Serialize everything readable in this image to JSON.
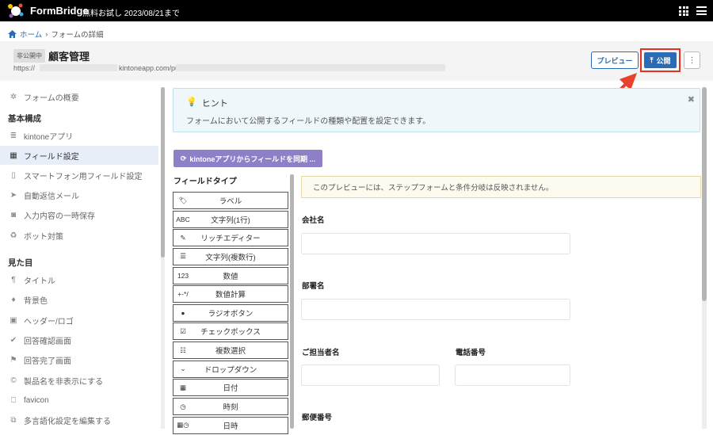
{
  "topbar": {
    "brand": "FormBridge",
    "trial_text": "無料お試し 2023/08/21まで"
  },
  "breadcrumb": {
    "home": "ホーム",
    "separator": "›",
    "current": "フォームの詳細"
  },
  "header": {
    "status_badge": "非公開中",
    "title": "顧客管理",
    "url_prefix": "https://",
    "url_middle": "kintoneapp.com/public/",
    "preview_button": "プレビュー",
    "publish_button": "公開",
    "more_button": "⋮"
  },
  "sidebar": {
    "overview": "フォームの概要",
    "section_basic": "基本構成",
    "basic_items": [
      {
        "label": "kintoneアプリ",
        "icon": "database-icon"
      },
      {
        "label": "フィールド設定",
        "icon": "grid-icon",
        "active": true
      },
      {
        "label": "スマートフォン用フィールド設定",
        "icon": "smartphone-icon"
      },
      {
        "label": "自動返信メール",
        "icon": "send-icon"
      },
      {
        "label": "入力内容の一時保存",
        "icon": "save-icon"
      },
      {
        "label": "ボット対策",
        "icon": "recycle-icon"
      }
    ],
    "section_appearance": "見た目",
    "appearance_items": [
      {
        "label": "タイトル",
        "icon": "paragraph-icon"
      },
      {
        "label": "背景色",
        "icon": "drop-icon"
      },
      {
        "label": "ヘッダー/ロゴ",
        "icon": "image-icon"
      },
      {
        "label": "回答確認画面",
        "icon": "check-icon"
      },
      {
        "label": "回答完了画面",
        "icon": "flag-icon"
      },
      {
        "label": "製品名を非表示にする",
        "icon": "copyright-icon"
      },
      {
        "label": "favicon",
        "icon": "bookmark-icon"
      },
      {
        "label": "多言語化設定を編集する",
        "icon": "language-icon"
      }
    ]
  },
  "hint": {
    "title": "ヒント",
    "text": "フォームにおいて公開するフィールドの種類や配置を設定できます。",
    "close": "✖"
  },
  "sync_button": "kintoneアプリからフィールドを同期 ...",
  "field_types": {
    "title": "フィールドタイプ",
    "items": [
      {
        "icon_text": "🏷",
        "label": "ラベル"
      },
      {
        "icon_text": "ABC",
        "label": "文字列(1行)"
      },
      {
        "icon_text": "✎",
        "label": "リッチエディター"
      },
      {
        "icon_text": "☰",
        "label": "文字列(複数行)"
      },
      {
        "icon_text": "123",
        "label": "数値"
      },
      {
        "icon_text": "+-*/",
        "label": "数値計算"
      },
      {
        "icon_text": "●",
        "label": "ラジオボタン"
      },
      {
        "icon_text": "☑",
        "label": "チェックボックス"
      },
      {
        "icon_text": "☷",
        "label": "複数選択"
      },
      {
        "icon_text": "⌄",
        "label": "ドロップダウン"
      },
      {
        "icon_text": "▦",
        "label": "日付"
      },
      {
        "icon_text": "◷",
        "label": "時刻"
      },
      {
        "icon_text": "▦◷",
        "label": "日時"
      }
    ]
  },
  "preview": {
    "notice": "このプレビューには、ステップフォームと条件分岐は反映されません。",
    "fields": {
      "company": "会社名",
      "department": "部署名",
      "contact": "ご担当者名",
      "phone": "電話番号",
      "postal": "郵便番号"
    }
  },
  "colors": {
    "accent": "#2a6bb5",
    "highlight": "#e53223",
    "sync": "#8e7fc7"
  }
}
